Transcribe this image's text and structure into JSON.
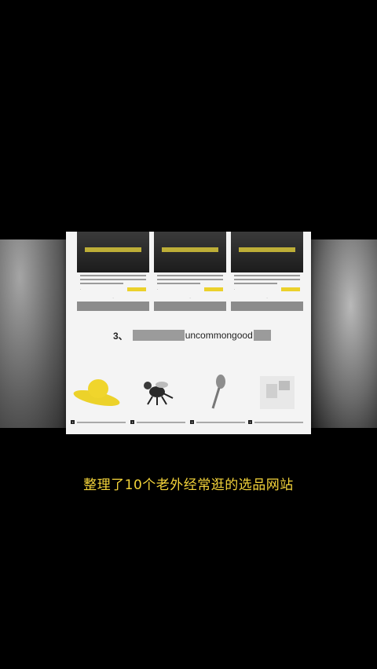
{
  "section": {
    "number": "3、",
    "site_name": "uncommongood"
  },
  "subtitle": "整理了10个老外经常逛的选品网站",
  "colors": {
    "accent_yellow": "#ebd12b",
    "subtitle_yellow": "#f3d33a"
  },
  "products": [
    {
      "icon": "yellow-hat-icon"
    },
    {
      "icon": "bee-figurine-icon"
    },
    {
      "icon": "spoon-icon"
    },
    {
      "icon": "mug-icon"
    }
  ]
}
